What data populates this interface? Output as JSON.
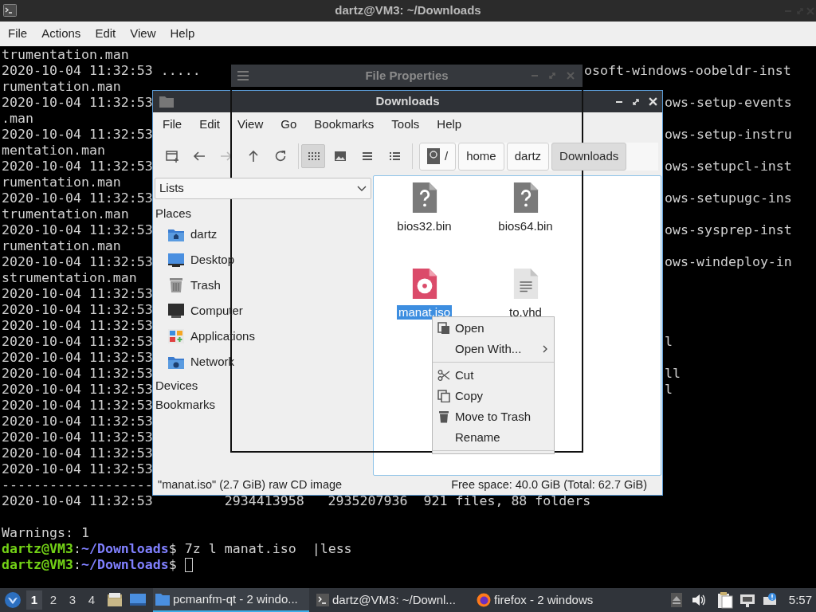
{
  "terminal": {
    "title": "dartz@VM3: ~/Downloads",
    "menu": [
      "File",
      "Actions",
      "Edit",
      "View",
      "Help"
    ],
    "lines": [
      {
        "kind": "output",
        "text": "trumentation.man"
      },
      {
        "kind": "output",
        "text": "2020-10-04 11:32:53 .....",
        "right": {
          "kind": "past-properties",
          "text": "osoft-windows-oobeldr-inst"
        }
      },
      {
        "kind": "output",
        "text": "rumentation.man"
      },
      {
        "kind": "output",
        "text": "2020-10-04 11:32:53",
        "right": {
          "kind": "past-downloads",
          "text": "ows-setup-events"
        }
      },
      {
        "kind": "output",
        "text": ".man"
      },
      {
        "kind": "output",
        "text": "2020-10-04 11:32:53",
        "right": {
          "kind": "past-downloads",
          "text": "ows-setup-instru"
        }
      },
      {
        "kind": "output",
        "text": "mentation.man"
      },
      {
        "kind": "output",
        "text": "2020-10-04 11:32:53",
        "right": {
          "kind": "past-downloads",
          "text": "ows-setupcl-inst"
        }
      },
      {
        "kind": "output",
        "text": "rumentation.man"
      },
      {
        "kind": "output",
        "text": "2020-10-04 11:32:53",
        "right": {
          "kind": "past-downloads",
          "text": "ows-setupugc-ins"
        }
      },
      {
        "kind": "output",
        "text": "trumentation.man"
      },
      {
        "kind": "output",
        "text": "2020-10-04 11:32:53",
        "right": {
          "kind": "past-downloads",
          "text": "ows-sysprep-inst"
        }
      },
      {
        "kind": "output",
        "text": "rumentation.man"
      },
      {
        "kind": "output",
        "text": "2020-10-04 11:32:53",
        "right": {
          "kind": "past-downloads",
          "text": "ows-windeploy-in"
        }
      },
      {
        "kind": "output",
        "text": "strumentation.man"
      },
      {
        "kind": "output",
        "text": "2020-10-04 11:32:53"
      },
      {
        "kind": "output",
        "text": "2020-10-04 11:32:53"
      },
      {
        "kind": "output",
        "text": "2020-10-04 11:32:53"
      },
      {
        "kind": "output",
        "text": "2020-10-04 11:32:53",
        "right": {
          "kind": "past-downloads",
          "text": "l"
        }
      },
      {
        "kind": "output",
        "text": "2020-10-04 11:32:53"
      },
      {
        "kind": "output",
        "text": "2020-10-04 11:32:53",
        "right": {
          "kind": "past-downloads",
          "text": "ll"
        }
      },
      {
        "kind": "output",
        "text": "2020-10-04 11:32:53",
        "right": {
          "kind": "past-downloads",
          "text": "l"
        }
      },
      {
        "kind": "output",
        "text": "2020-10-04 11:32:53"
      },
      {
        "kind": "output",
        "text": "2020-10-04 11:32:53"
      },
      {
        "kind": "output",
        "text": "2020-10-04 11:32:53"
      },
      {
        "kind": "output",
        "text": "2020-10-04 11:32:53"
      },
      {
        "kind": "output",
        "text": "2020-10-04 11:32:53"
      },
      {
        "kind": "output",
        "text": "-------------------"
      },
      {
        "kind": "output",
        "text": "2020-10-04 11:32:53         2934413958   2935207936  921 files, 88 folders"
      },
      {
        "kind": "blank"
      },
      {
        "kind": "output",
        "text": "Warnings: 1"
      },
      {
        "kind": "prompt",
        "user_host": "dartz@VM3",
        "separator": ":",
        "path": "~/Downloads",
        "symbol": "$",
        "command": " 7z l manat.iso  |less"
      },
      {
        "kind": "prompt",
        "user_host": "dartz@VM3",
        "separator": ":",
        "path": "~/Downloads",
        "symbol": "$",
        "cursor": true
      }
    ]
  },
  "properties_window": {
    "title": "File Properties"
  },
  "file_manager": {
    "title": "Downloads",
    "menu": [
      "File",
      "Edit",
      "View",
      "Go",
      "Bookmarks",
      "Tools",
      "Help"
    ],
    "nav_buttons": [
      {
        "disabled": false
      },
      {
        "disabled": false
      },
      {
        "disabled": true
      },
      {
        "disabled": false
      },
      {
        "disabled": false
      }
    ],
    "view_modes": [
      {
        "selected": true
      },
      {
        "selected": false
      },
      {
        "selected": false
      },
      {
        "selected": false
      }
    ],
    "breadcrumb": [
      {
        "label": "/",
        "selected": false
      },
      {
        "label": "home",
        "selected": false
      },
      {
        "label": "dartz",
        "selected": false
      },
      {
        "label": "Downloads",
        "selected": true
      }
    ],
    "side_pane": {
      "selector": "Lists",
      "sections": [
        {
          "title": "Places",
          "items": [
            "dartz",
            "Desktop",
            "Trash",
            "Computer",
            "Applications",
            "Network"
          ]
        },
        {
          "title": "Devices"
        },
        {
          "title": "Bookmarks"
        }
      ]
    },
    "files": [
      {
        "name": "bios32.bin",
        "kind": "unknown",
        "selected": false
      },
      {
        "name": "bios64.bin",
        "kind": "unknown",
        "selected": false
      },
      {
        "name": "manat.iso",
        "kind": "disc",
        "selected": true
      },
      {
        "name": "to.vhd",
        "kind": "text",
        "selected": false
      }
    ],
    "context_menu": [
      {
        "kind": "item",
        "label": "Open"
      },
      {
        "kind": "item",
        "label": "Open With...",
        "submenu": true
      },
      {
        "kind": "separator"
      },
      {
        "kind": "item",
        "label": "Cut"
      },
      {
        "kind": "item",
        "label": "Copy"
      },
      {
        "kind": "item",
        "label": "Move to Trash"
      },
      {
        "kind": "item",
        "label": "Rename"
      },
      {
        "kind": "separator"
      }
    ],
    "status_left": "\"manat.iso\" (2.7 GiB) raw CD image",
    "status_right": "Free space: 40.0 GiB (Total: 62.7 GiB)"
  },
  "taskbar": {
    "workspaces": [
      {
        "label": "1",
        "selected": true
      },
      {
        "label": "2",
        "selected": false
      },
      {
        "label": "3",
        "selected": false
      },
      {
        "label": "4",
        "selected": false
      }
    ],
    "tasks": [
      {
        "label": "pcmanfm-qt - 2 windo...",
        "selected": true
      },
      {
        "label": "dartz@VM3: ~/Downl...",
        "selected": false
      },
      {
        "label": "firefox - 2 windows",
        "selected": false
      }
    ],
    "clock": "5:57"
  }
}
